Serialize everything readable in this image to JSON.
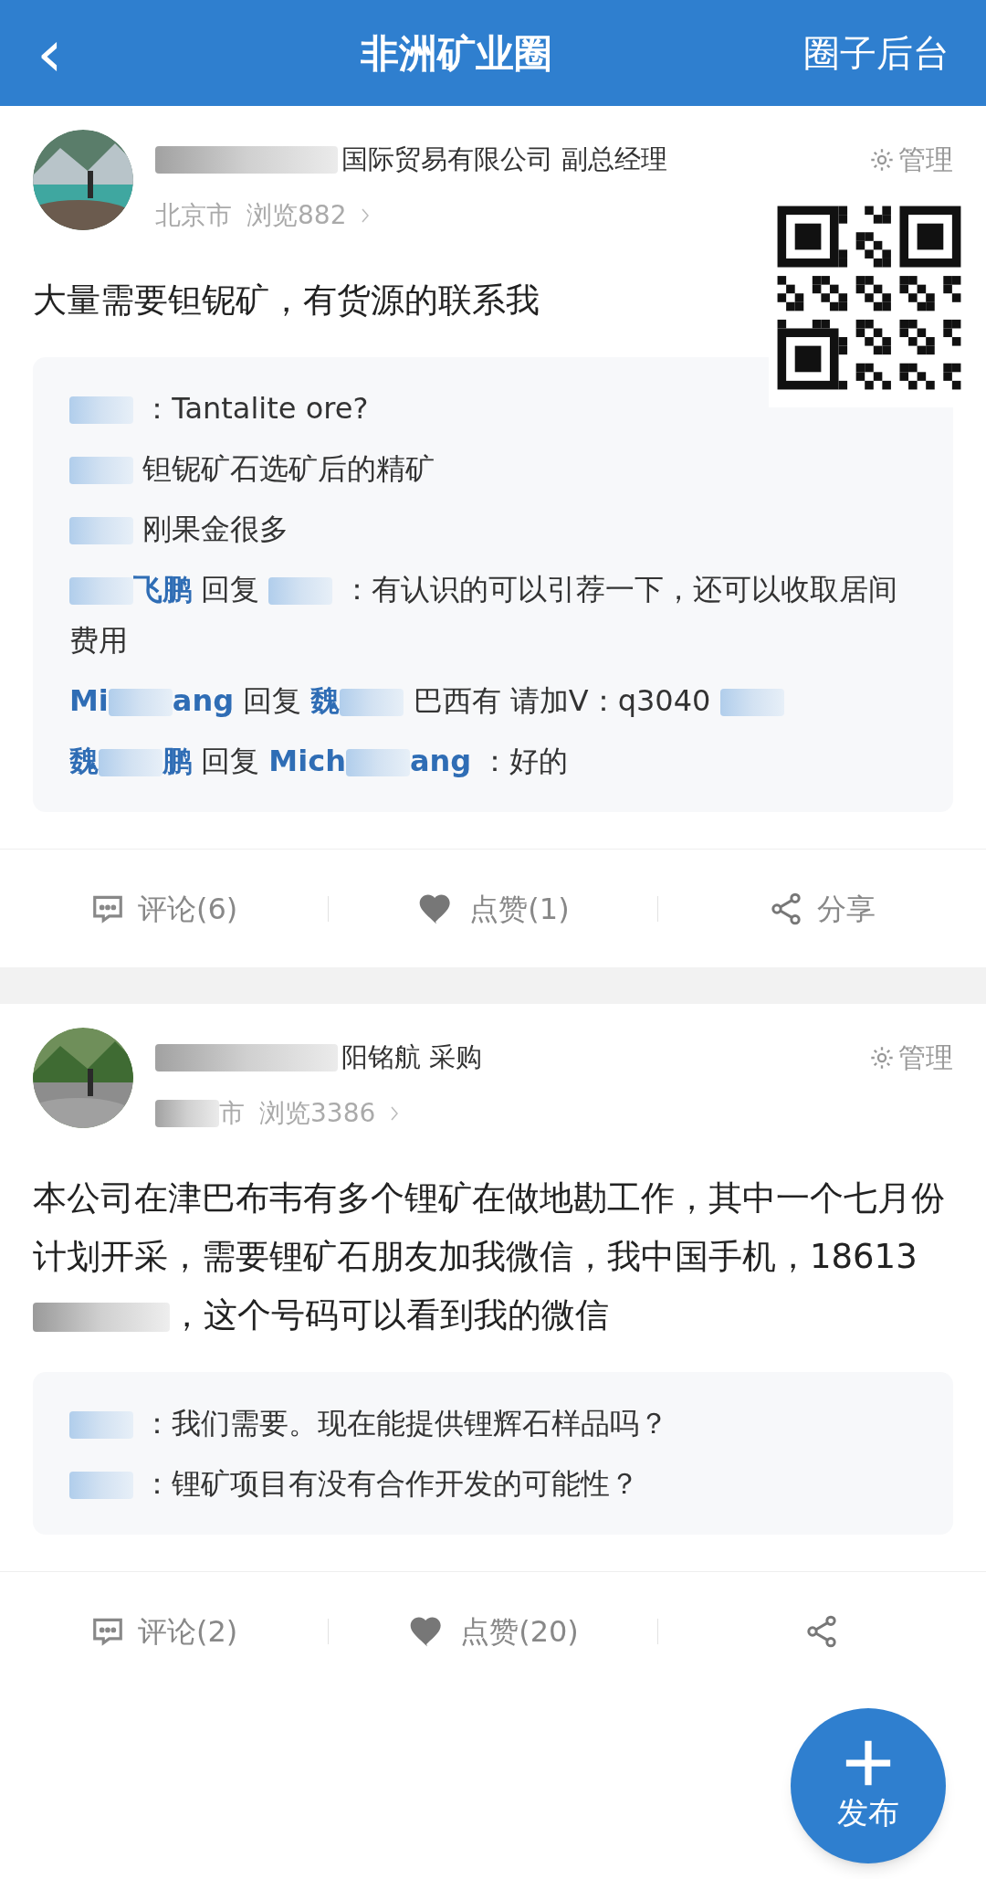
{
  "header": {
    "back": "‹",
    "title": "非洲矿业圈",
    "action": "圈子后台"
  },
  "posts": [
    {
      "name_line": [
        {
          "kind": "blur"
        },
        {
          "kind": "text",
          "text": "国际贸易有限公司 副总经理"
        }
      ],
      "manage": "管理",
      "location": [
        {
          "kind": "text",
          "text": "北京市"
        }
      ],
      "views": "浏览882",
      "qr_overlay": true,
      "content": [
        {
          "kind": "text",
          "text": "大量需要钽铌矿，有货源的联系我"
        }
      ],
      "comments": [
        {
          "segments": [
            {
              "kind": "blur"
            },
            {
              "kind": "text",
              "text": "：Tantalite ore?"
            }
          ]
        },
        {
          "segments": [
            {
              "kind": "blur"
            },
            {
              "kind": "text",
              "text": "钽铌矿石选矿后的精矿"
            }
          ]
        },
        {
          "segments": [
            {
              "kind": "blur"
            },
            {
              "kind": "text",
              "text": "刚果金很多"
            }
          ]
        },
        {
          "segments": [
            {
              "kind": "blur"
            },
            {
              "kind": "name",
              "text": "飞鹏"
            },
            {
              "kind": "text",
              "text": "回复"
            },
            {
              "kind": "blur"
            },
            {
              "kind": "text",
              "text": "：有认识的可以引荐一下，还可以收取居间费用"
            }
          ]
        },
        {
          "segments": [
            {
              "kind": "name",
              "text": "Mi"
            },
            {
              "kind": "blur"
            },
            {
              "kind": "name",
              "text": "ang"
            },
            {
              "kind": "text",
              "text": "回复"
            },
            {
              "kind": "name",
              "text": "魏"
            },
            {
              "kind": "blur"
            },
            {
              "kind": "text",
              "text": "巴西有 请加V：q3040"
            },
            {
              "kind": "blur"
            }
          ]
        },
        {
          "segments": [
            {
              "kind": "name",
              "text": "魏"
            },
            {
              "kind": "blur"
            },
            {
              "kind": "name",
              "text": "鹏"
            },
            {
              "kind": "text",
              "text": "回复"
            },
            {
              "kind": "name",
              "text": "Mich"
            },
            {
              "kind": "blur"
            },
            {
              "kind": "name",
              "text": "ang"
            },
            {
              "kind": "text",
              "text": "：好的"
            }
          ]
        }
      ],
      "actions": [
        {
          "kind": "comment",
          "label": "评论(6)"
        },
        {
          "kind": "like",
          "label": "点赞(1)"
        },
        {
          "kind": "share",
          "label": "分享"
        }
      ]
    },
    {
      "name_line": [
        {
          "kind": "blur"
        },
        {
          "kind": "text",
          "text": "阳铭航 采购"
        }
      ],
      "manage": "管理",
      "location": [
        {
          "kind": "blur"
        },
        {
          "kind": "text",
          "text": "市"
        }
      ],
      "views": "浏览3386",
      "qr_overlay": false,
      "content": [
        {
          "kind": "text",
          "text": "本公司在津巴布韦有多个锂矿在做地勘工作，其中一个七月份计划开采，需要锂矿石朋友加我微信，我中国手机，18613"
        },
        {
          "kind": "blur"
        },
        {
          "kind": "text",
          "text": "，这个号码可以看到我的微信"
        }
      ],
      "comments": [
        {
          "segments": [
            {
              "kind": "blur"
            },
            {
              "kind": "text",
              "text": "：我们需要。现在能提供锂辉石样品吗？"
            }
          ]
        },
        {
          "segments": [
            {
              "kind": "blur"
            },
            {
              "kind": "text",
              "text": "：锂矿项目有没有合作开发的可能性？"
            }
          ]
        }
      ],
      "actions": [
        {
          "kind": "comment",
          "label": "评论(2)"
        },
        {
          "kind": "like",
          "label": "点赞(20)"
        },
        {
          "kind": "share"
        }
      ]
    }
  ],
  "fab": {
    "label": "发布"
  }
}
